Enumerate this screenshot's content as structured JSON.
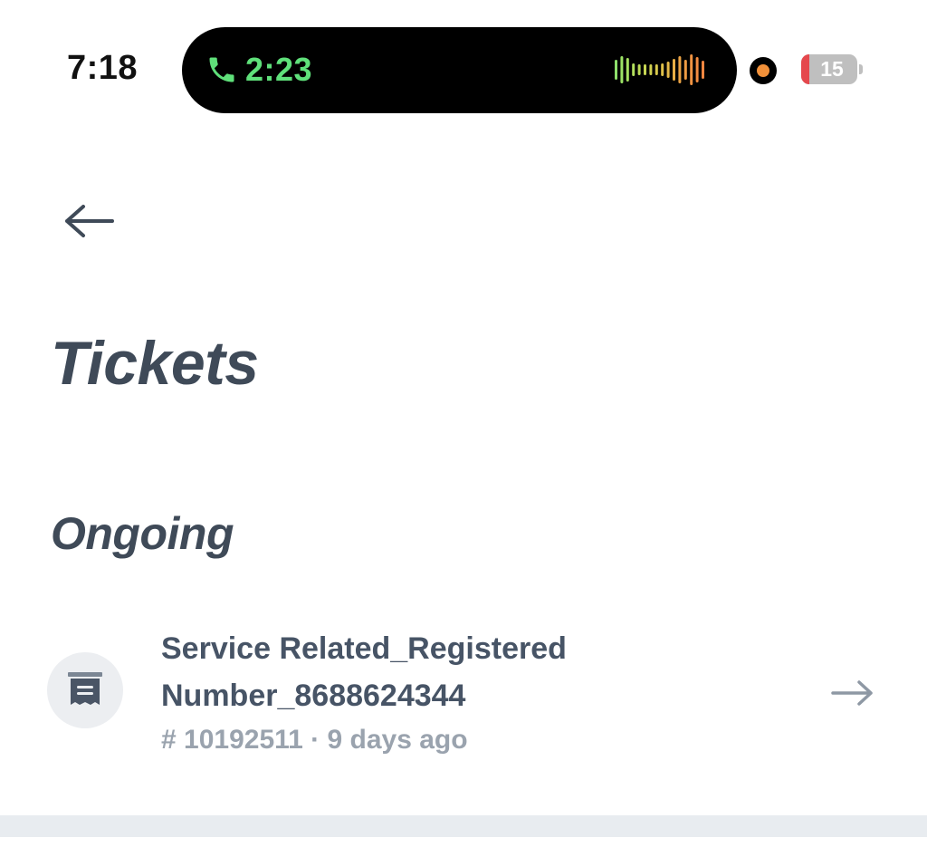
{
  "status_bar": {
    "time": "7:18",
    "call_timer": "2:23",
    "battery_level": "15",
    "battery_fraction": 0.15,
    "call_color": "#5fe07a",
    "recording_color": "#f2913a",
    "battery_low_color": "#e5484d"
  },
  "page": {
    "title": "Tickets",
    "back_icon": "arrow-left-icon"
  },
  "sections": [
    {
      "title": "Ongoing",
      "tickets": [
        {
          "title": "Service Related_Registered Number_8688624344",
          "meta": "# 10192511 · 9 days ago",
          "icon": "ticket-receipt-icon",
          "action_icon": "arrow-right-icon"
        }
      ]
    }
  ]
}
